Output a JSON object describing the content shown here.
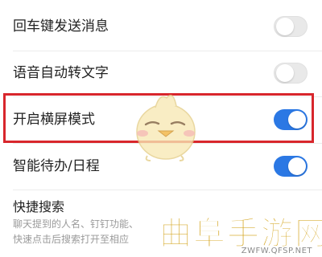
{
  "settings": {
    "rows": [
      {
        "label": "回车键发送消息",
        "enabled": false
      },
      {
        "label": "语音自动转文字",
        "enabled": false
      },
      {
        "label": "开启横屏模式",
        "enabled": true
      },
      {
        "label": "智能待办/日程",
        "enabled": true
      }
    ]
  },
  "quick_search": {
    "title": "快捷搜索",
    "desc_line1": "聊天提到的人名、钉钉功能、",
    "desc_line2": "快速点击后搜索打开至相应"
  },
  "watermark": {
    "main_text": "曲阜手游网",
    "url_text": "ZWFW.QFSP.NET"
  },
  "colors": {
    "toggle_on": "#2b78e4",
    "toggle_off": "#e9e9e9",
    "highlight_border": "#d8262c",
    "watermark": "#d4a51f"
  },
  "icons": {
    "mascot": "yellow-chick-mascot-icon"
  }
}
